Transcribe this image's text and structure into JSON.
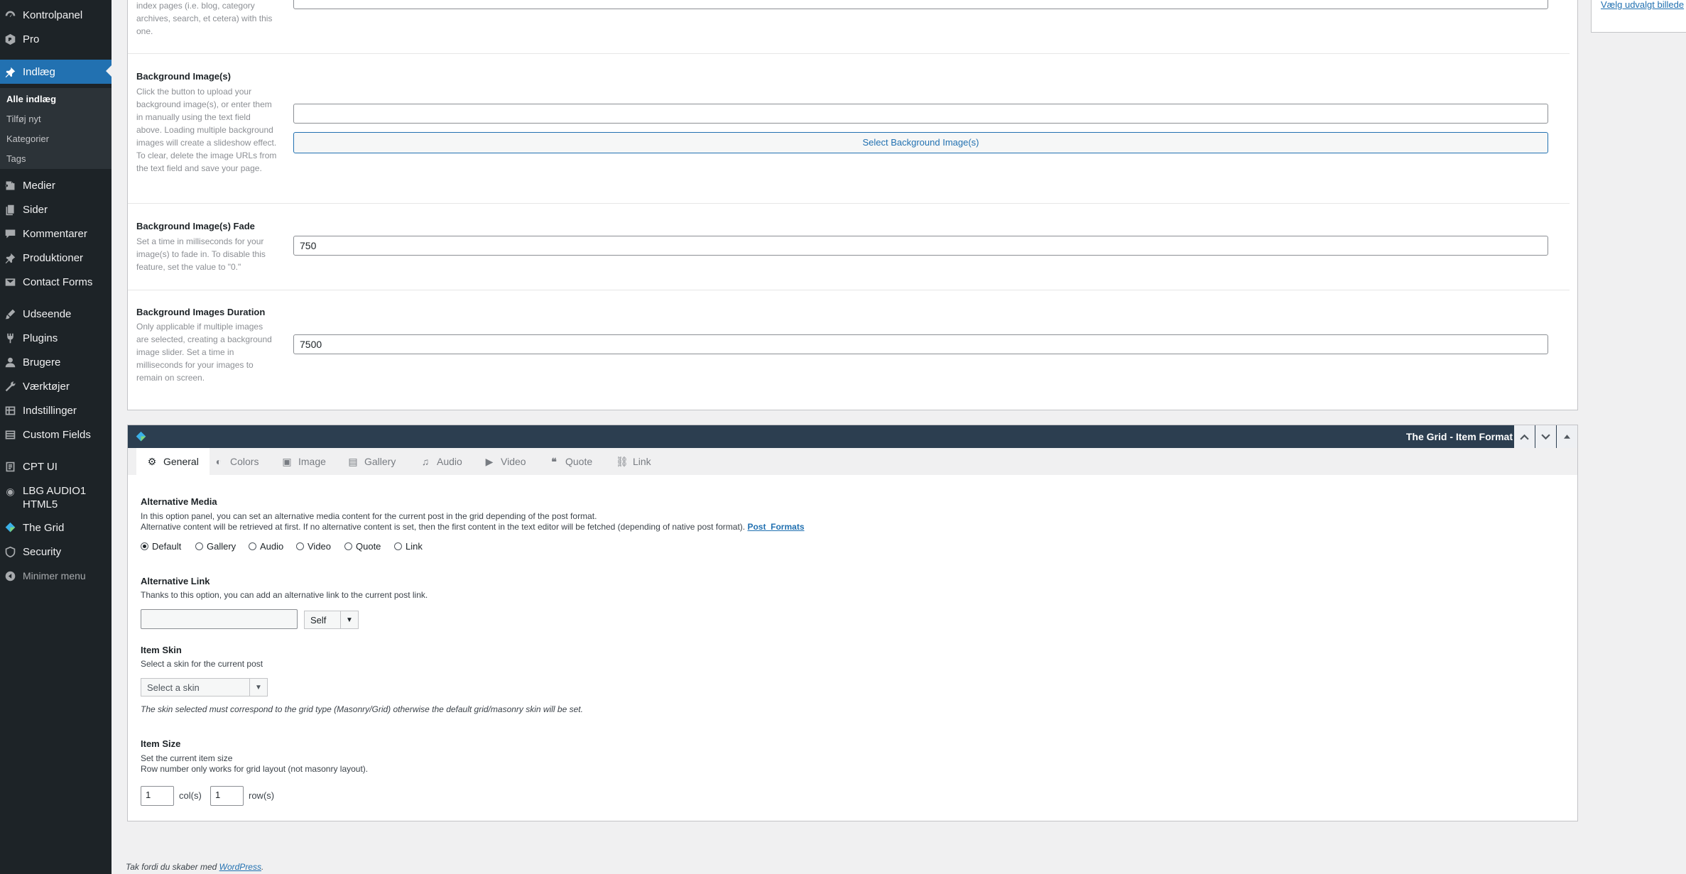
{
  "sidebar": {
    "items": [
      {
        "label": "Kontrolpanel",
        "icon": "dashboard-icon"
      },
      {
        "label": "Pro",
        "icon": "pro-icon"
      },
      {
        "label": "Indlæg",
        "icon": "pin-icon"
      },
      {
        "label": "Medier",
        "icon": "media-icon"
      },
      {
        "label": "Sider",
        "icon": "pages-icon"
      },
      {
        "label": "Kommentarer",
        "icon": "comments-icon"
      },
      {
        "label": "Produktioner",
        "icon": "pin-icon"
      },
      {
        "label": "Contact Forms",
        "icon": "envelope-icon"
      },
      {
        "label": "Udseende",
        "icon": "brush-icon"
      },
      {
        "label": "Plugins",
        "icon": "plugin-icon"
      },
      {
        "label": "Brugere",
        "icon": "users-icon"
      },
      {
        "label": "Værktøjer",
        "icon": "wrench-icon"
      },
      {
        "label": "Indstillinger",
        "icon": "settings-icon"
      },
      {
        "label": "Custom Fields",
        "icon": "table-icon"
      },
      {
        "label": "CPT UI",
        "icon": "cpt-icon"
      },
      {
        "label": "LBG AUDIO1",
        "label2": "HTML5",
        "icon": "audio-icon"
      },
      {
        "label": "The Grid",
        "icon": "grid-logo-icon"
      },
      {
        "label": "Security",
        "icon": "shield-icon"
      },
      {
        "label": "Minimer menu",
        "icon": "collapse-icon"
      }
    ],
    "submenu": [
      "Alle indlæg",
      "Tilføj nyt",
      "Kategorier",
      "Tags"
    ]
  },
  "options": {
    "top_desc": "index pages (i.e. blog, category archives, search, et cetera) with this one.",
    "bg_images": {
      "label": "Background Image(s)",
      "desc": "Click the button to upload your background image(s), or enter them in manually using the text field above. Loading multiple background images will create a slideshow effect. To clear, delete the image URLs from the text field and save your page.",
      "value": "",
      "button": "Select Background Image(s)"
    },
    "bg_fade": {
      "label": "Background Image(s) Fade",
      "desc": "Set a time in milliseconds for your image(s) to fade in. To disable this feature, set the value to \"0.\"",
      "value": "750"
    },
    "bg_duration": {
      "label": "Background Images Duration",
      "desc": "Only applicable if multiple images are selected, creating a background image slider. Set a time in milliseconds for your images to remain on screen.",
      "value": "7500"
    }
  },
  "grid": {
    "title": "The Grid - Item Format",
    "header_buttons": [
      "chevron-up-icon",
      "chevron-down-icon",
      "triangle-up-icon"
    ],
    "tabs": [
      {
        "label": "General",
        "icon": "gear-icon"
      },
      {
        "label": "Colors",
        "icon": "palette-icon"
      },
      {
        "label": "Image",
        "icon": "image-icon"
      },
      {
        "label": "Gallery",
        "icon": "gallery-icon"
      },
      {
        "label": "Audio",
        "icon": "music-icon"
      },
      {
        "label": "Video",
        "icon": "video-icon"
      },
      {
        "label": "Quote",
        "icon": "quote-icon"
      },
      {
        "label": "Link",
        "icon": "link-icon"
      }
    ],
    "alt_media": {
      "title": "Alternative Media",
      "line1": "In this option panel, you can set an alternative media content for the current post in the grid depending of the post format.",
      "line2": "Alternative content will be retrieved at first. If no alternative content is set, then the first content in the text editor will be fetched (depending of native post format).",
      "link": "Post_Formats",
      "options": [
        "Default",
        "Gallery",
        "Audio",
        "Video",
        "Quote",
        "Link"
      ],
      "selected": "Default"
    },
    "alt_link": {
      "title": "Alternative Link",
      "desc": "Thanks to this option, you can add an alternative link to the current post link.",
      "value": "",
      "target": "Self"
    },
    "item_skin": {
      "title": "Item Skin",
      "desc": "Select a skin for the current post",
      "placeholder": "Select a skin",
      "note": "The skin selected must correspond to the grid type (Masonry/Grid) otherwise the default grid/masonry skin will be set."
    },
    "item_size": {
      "title": "Item Size",
      "line1": "Set the current item size",
      "line2": "Row number only works for grid layout (not masonry layout).",
      "cols": "1",
      "cols_label": "col(s)",
      "rows": "1",
      "rows_label": "row(s)"
    }
  },
  "footer": {
    "thanks": "Tak fordi du skaber med",
    "link": "WordPress",
    "after": "."
  },
  "right_panel": {
    "link": "Vælg udvalgt billede"
  }
}
